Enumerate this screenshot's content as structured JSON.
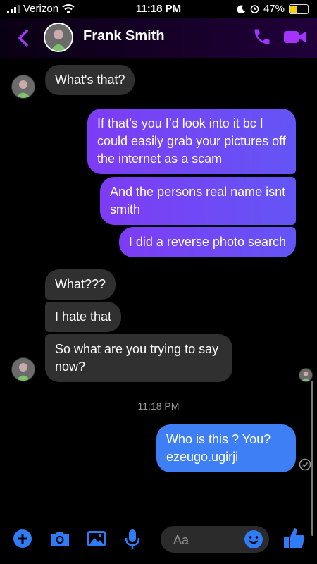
{
  "status": {
    "carrier": "Verizon",
    "time": "11:18 PM",
    "battery": "47%",
    "battery_level": 0.47,
    "icons": [
      "signal-icon",
      "wifi-icon",
      "moon-icon",
      "alarm-icon",
      "battery-icon"
    ]
  },
  "header": {
    "contact_name": "Frank Smith",
    "icons": [
      "back-arrow-icon",
      "phone-icon",
      "video-icon"
    ],
    "accent": "#a533ff"
  },
  "messages": [
    {
      "text": "What's that?"
    },
    {
      "text": "If that’s you I’d look into it bc I could easily grab your pictures off the internet as a scam"
    },
    {
      "text": "And the persons real name isnt smith"
    },
    {
      "text": "I did a reverse photo search"
    },
    {
      "text": "What???"
    },
    {
      "text": "I hate that"
    },
    {
      "text": "So what are you trying to say now?"
    },
    {
      "text": "Who is this ? You? ezeugo.ugirji"
    }
  ],
  "timestamp": "11:18 PM",
  "composer": {
    "placeholder": "Aa",
    "icons": [
      "plus-icon",
      "camera-icon",
      "image-icon",
      "mic-icon",
      "emoji-icon",
      "thumbs-up-icon"
    ]
  },
  "colors": {
    "incoming": "#303030",
    "outgoing_start": "#7d3cf5",
    "outgoing_end": "#6455f5",
    "sent_blue": "#3e7ff5",
    "accent_blue": "#2f7cf6"
  }
}
